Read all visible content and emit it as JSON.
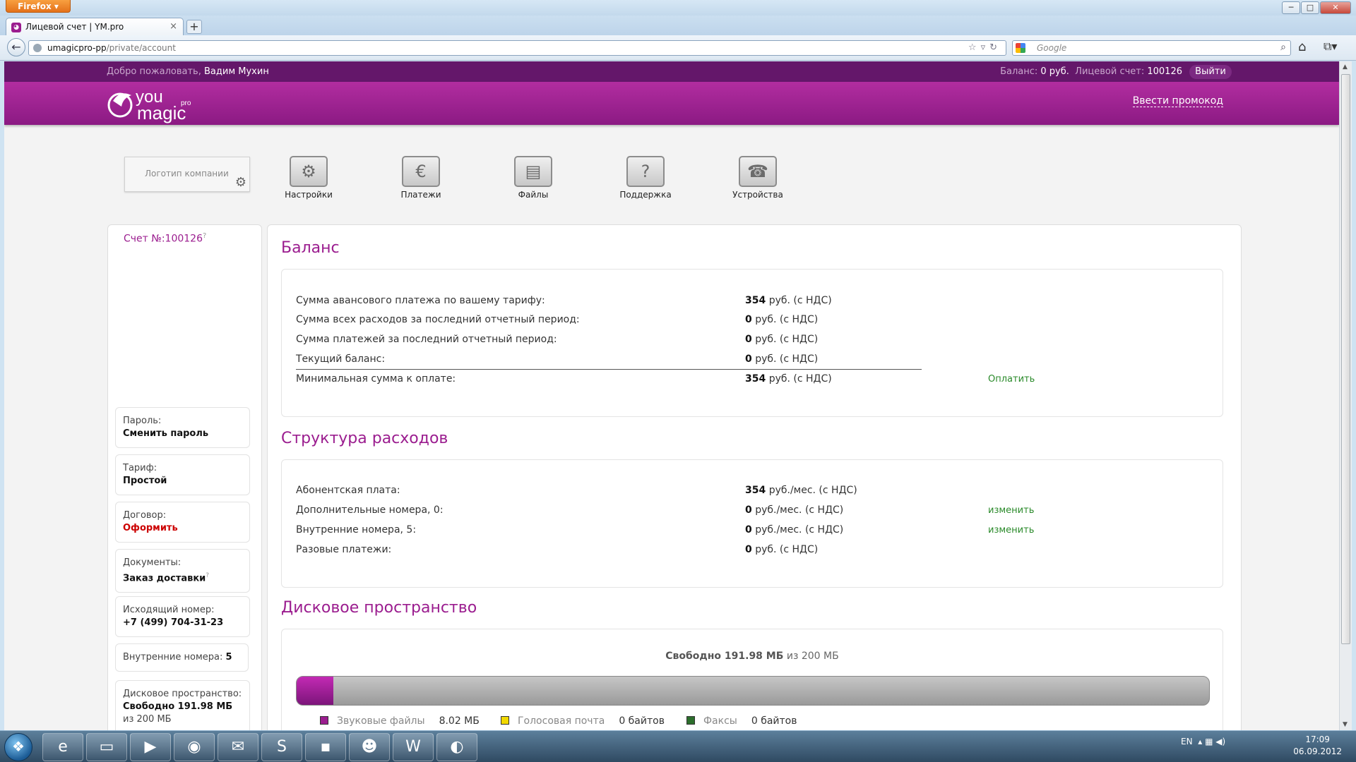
{
  "browser": {
    "menu_label": "Firefox",
    "tab_title": "Лицевой счет | YM.pro",
    "tab_close": "×",
    "newtab_label": "+",
    "url_host": "umagicpro-pp",
    "url_path": "/private/account",
    "search_placeholder": "Google",
    "window_controls": [
      "─",
      "□",
      "✕"
    ]
  },
  "site": {
    "welcome_prefix": "Добро пожаловать,",
    "user_name": "Вадим Мухин",
    "balance_label": "Баланс:",
    "balance_value": "0 руб.",
    "account_label": "Лицевой счет:",
    "account_value": "100126",
    "logout_label": "Выйти",
    "promo_link": "Ввести промокод",
    "logo_top": "you",
    "logo_bottom": "magic",
    "logo_sup": "pro"
  },
  "quick_nav": {
    "company_logo_label": "Логотип компании",
    "items": [
      {
        "label": "Настройки",
        "icon": "settings-gears-icon"
      },
      {
        "label": "Платежи",
        "icon": "payments-icon"
      },
      {
        "label": "Файлы",
        "icon": "files-folder-icon"
      },
      {
        "label": "Поддержка",
        "icon": "support-question-icon"
      },
      {
        "label": "Устройства",
        "icon": "devices-phone-icon"
      }
    ]
  },
  "sidebar": {
    "account_no": "Счет №:100126",
    "boxes": [
      {
        "key": "Пароль:",
        "value": "Сменить пароль"
      },
      {
        "key": "Тариф:",
        "value": "Простой"
      },
      {
        "key": "Договор:",
        "value": "Оформить"
      },
      {
        "key": "Документы:",
        "value": "Заказ доставки"
      },
      {
        "key": "Исходящий номер:",
        "value": "+7 (499) 704-31-23"
      },
      {
        "key": "Внутренние номера:",
        "value": "5"
      },
      {
        "key": "Дисковое пространство:",
        "value": "Свободно 191.98 МБ",
        "extra": "из 200 МБ"
      }
    ]
  },
  "balance": {
    "title": "Баланс",
    "rows": [
      {
        "label": "Сумма авансового платежа по вашему тарифу:",
        "amount": "354",
        "unit": "руб. (с НДС)"
      },
      {
        "label": "Сумма всех расходов за последний отчетный период:",
        "amount": "0",
        "unit": "руб. (с НДС)"
      },
      {
        "label": "Сумма платежей за последний отчетный период:",
        "amount": "0",
        "unit": "руб. (с НДС)"
      },
      {
        "label": "Текущий баланс:",
        "amount": "0",
        "unit": "руб. (с НДС)"
      },
      {
        "label": "Минимальная сумма к оплате:",
        "amount": "354",
        "unit": "руб. (с НДС)",
        "action": "Оплатить"
      }
    ]
  },
  "expenses": {
    "title": "Структура расходов",
    "rows": [
      {
        "label": "Абонентская плата:",
        "amount": "354",
        "unit": "руб./мес. (с НДС)"
      },
      {
        "label": "Дополнительные номера, 0:",
        "amount": "0",
        "unit": "руб./мес. (с НДС)",
        "action": "изменить"
      },
      {
        "label": "Внутренние номера, 5:",
        "amount": "0",
        "unit": "руб./мес. (с НДС)",
        "action": "изменить"
      },
      {
        "label": "Разовые платежи:",
        "amount": "0",
        "unit": "руб. (с НДС)"
      }
    ]
  },
  "disk": {
    "title": "Дисковое пространство",
    "free_prefix": "Свободно 191.98 МБ",
    "free_suffix": "из 200 МБ",
    "used_fraction": 0.04,
    "colors": {
      "sound": "#9b1d8f",
      "voicemail": "#f2d900",
      "fax": "#2c6e2c"
    },
    "legend": [
      {
        "label": "Звуковые файлы",
        "size": "8.02 МБ"
      },
      {
        "label": "Голосовая почта",
        "size": "0 байтов"
      },
      {
        "label": "Факсы",
        "size": "0 байтов"
      }
    ]
  },
  "taskbar": {
    "lang": "EN",
    "time": "17:09",
    "date": "06.09.2012"
  }
}
